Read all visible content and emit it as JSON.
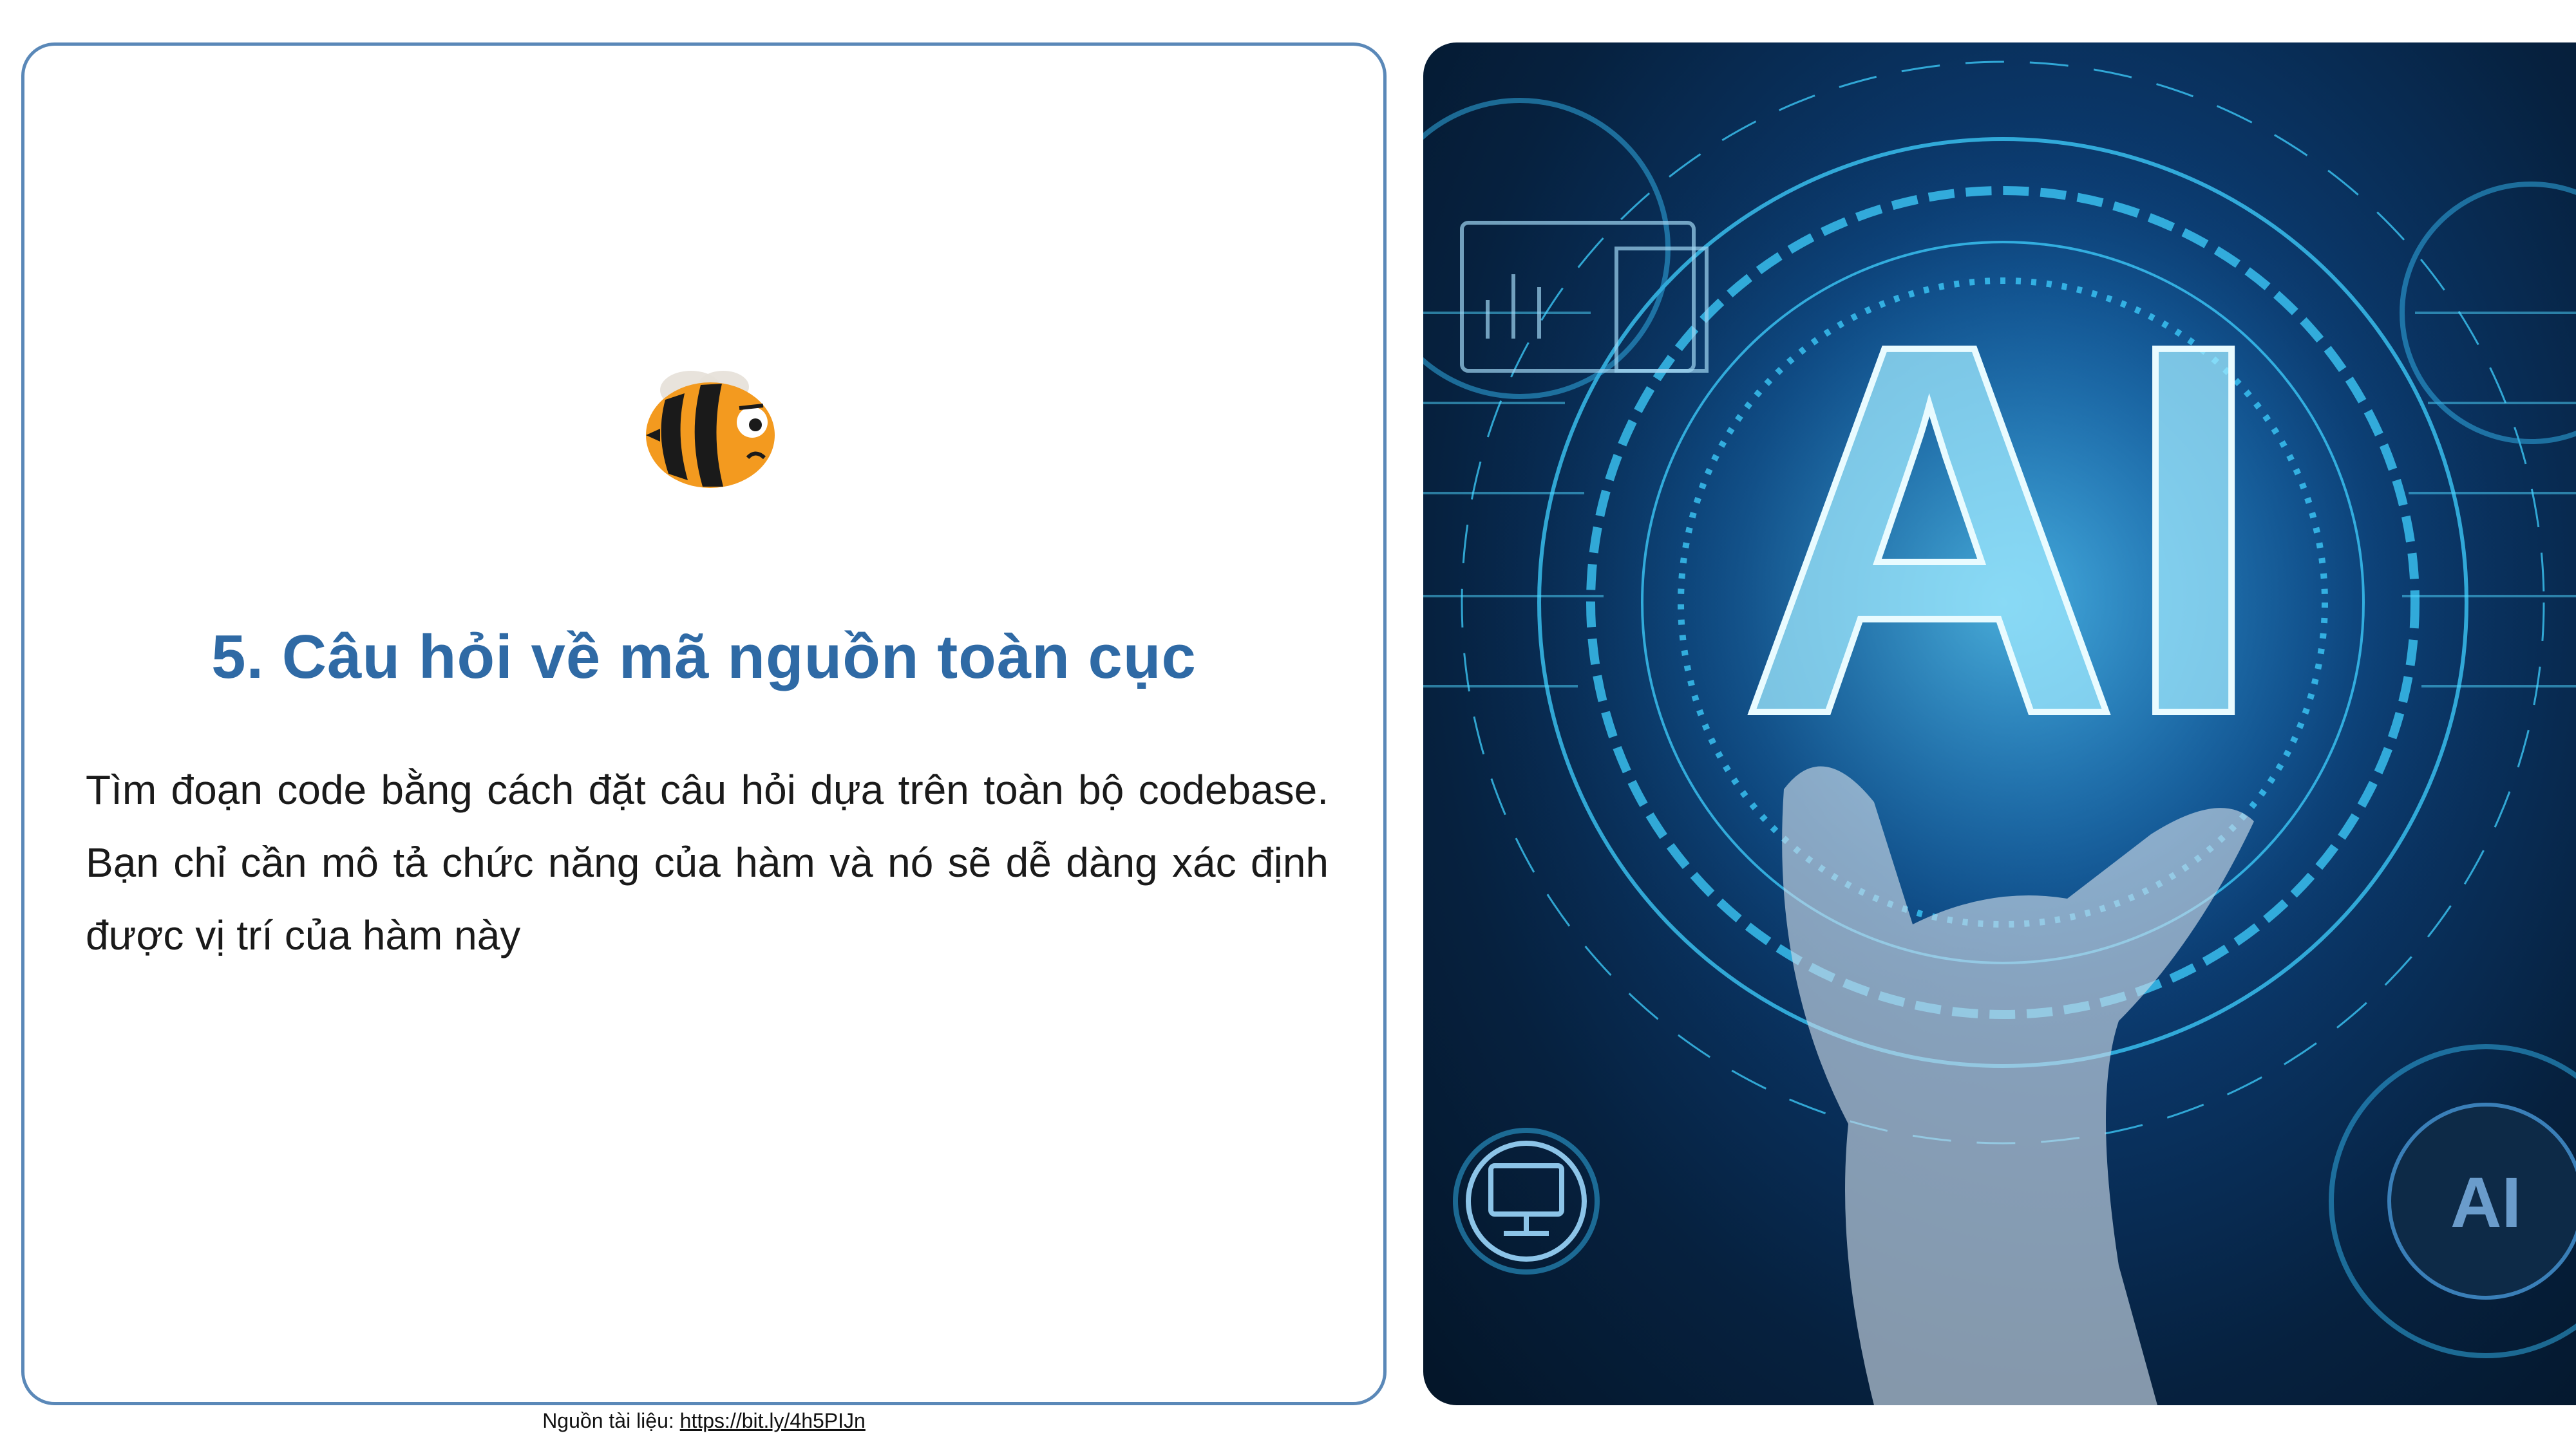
{
  "slide": {
    "title": "5. Câu hỏi về mã nguồn toàn cục",
    "description": "Tìm đoạn code bằng cách đặt câu hỏi dựa trên toàn bộ codebase. Bạn chỉ cần mô tả chức năng của hàm và nó sẽ dễ dàng xác định được vị trí của hàm này",
    "source_label": "Nguồn tài liệu:",
    "source_link": "https://bit.ly/4h5PIJn"
  },
  "hero_image": {
    "icon": "ai-hand-hologram-image",
    "text": "AI",
    "badge_text": "AI"
  },
  "colors": {
    "title": "#2f6aa5",
    "card_border": "#5a88b8",
    "accent_glow": "#3fd0ff"
  },
  "mascot": {
    "icon": "bee-mascot-icon"
  }
}
